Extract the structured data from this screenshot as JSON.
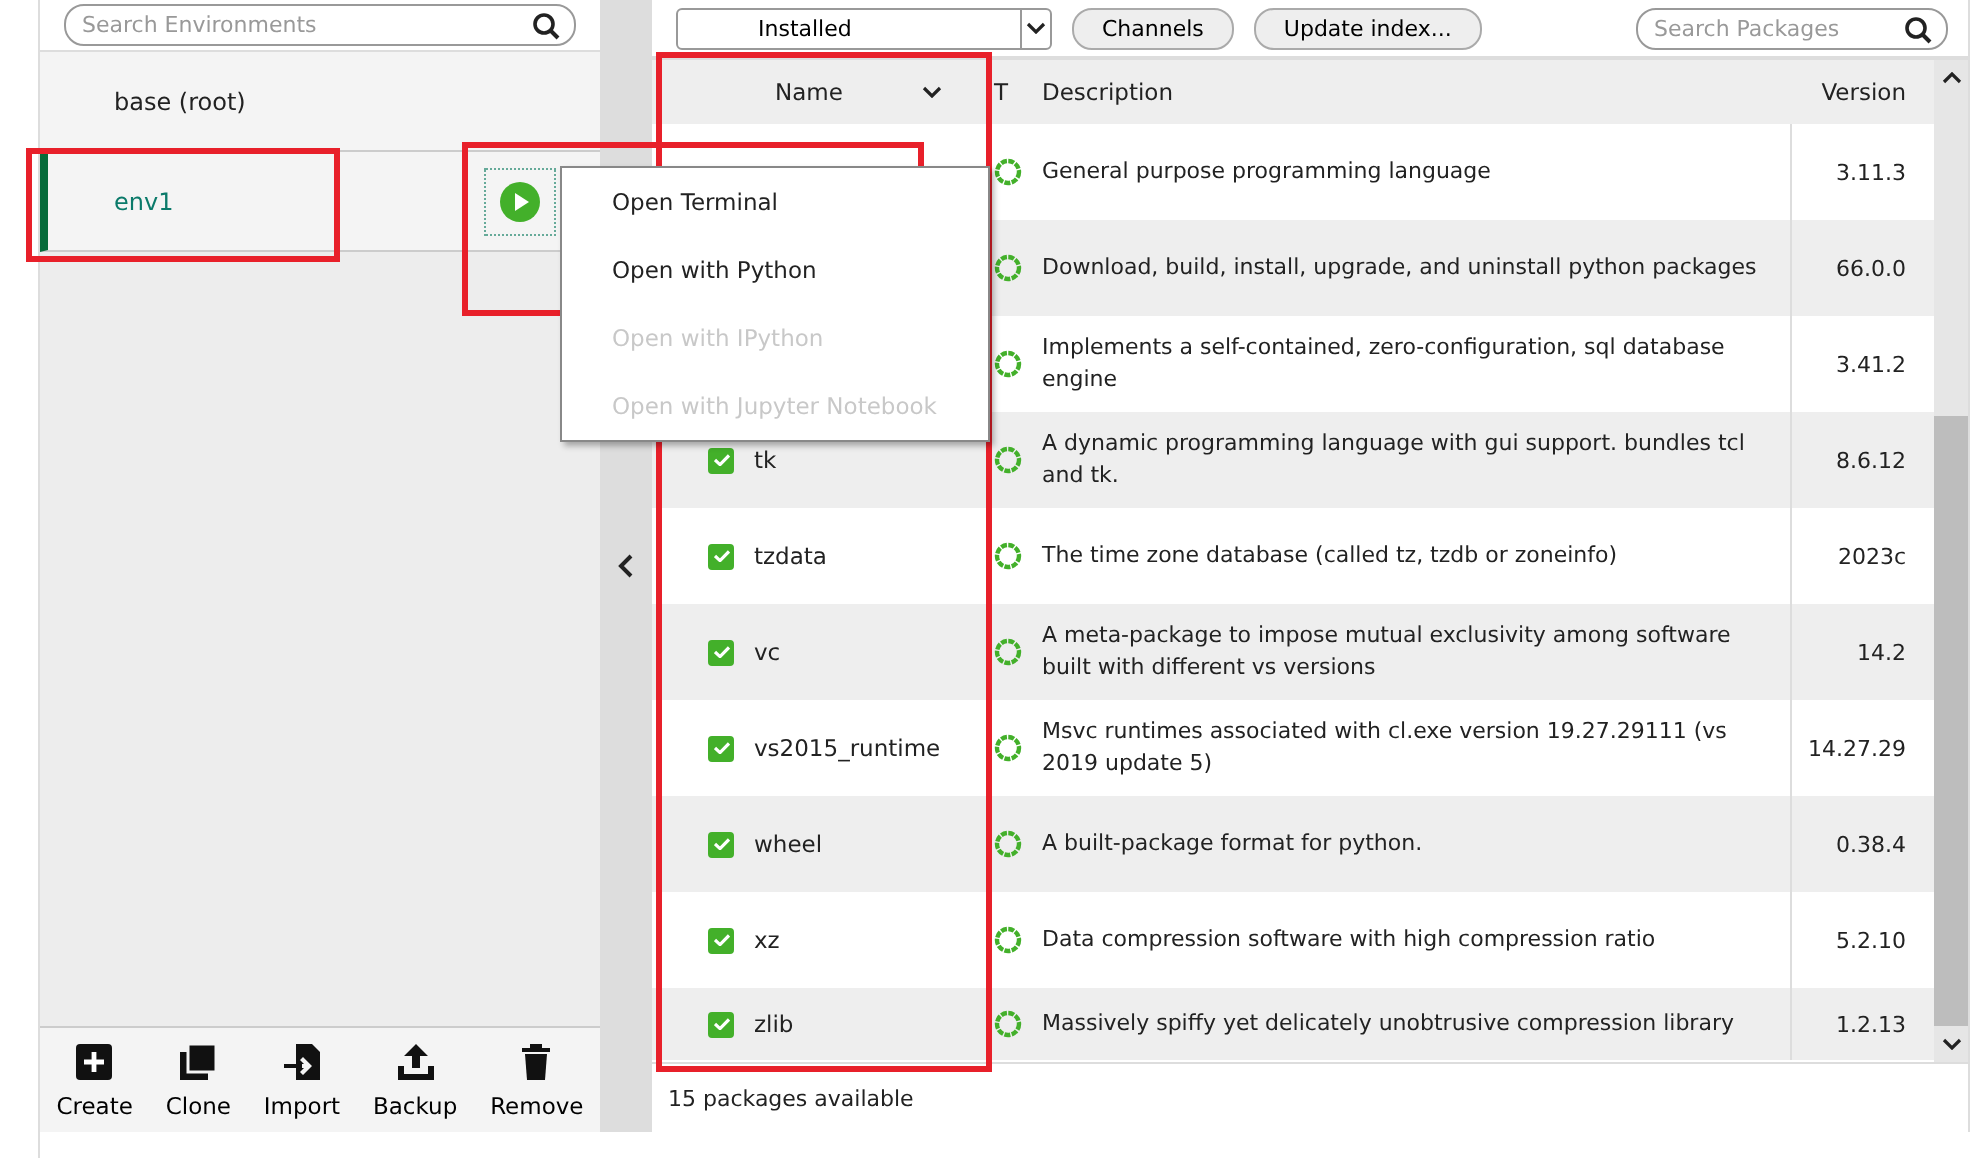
{
  "environments": {
    "search": {
      "placeholder": "Search Environments"
    },
    "items": [
      {
        "name": "base (root)",
        "selected": false,
        "running": false
      },
      {
        "name": "env1",
        "selected": true,
        "running": true
      }
    ],
    "actions": [
      {
        "kind": "create",
        "label": "Create"
      },
      {
        "kind": "clone",
        "label": "Clone"
      },
      {
        "kind": "import",
        "label": "Import"
      },
      {
        "kind": "backup",
        "label": "Backup"
      },
      {
        "kind": "remove",
        "label": "Remove"
      }
    ]
  },
  "context_menu": {
    "items": [
      {
        "label": "Open Terminal",
        "disabled": false
      },
      {
        "label": "Open with Python",
        "disabled": false
      },
      {
        "label": "Open with IPython",
        "disabled": true
      },
      {
        "label": "Open with Jupyter Notebook",
        "disabled": true
      }
    ]
  },
  "packages": {
    "filter": "Installed",
    "buttons": [
      "Channels",
      "Update index..."
    ],
    "search": {
      "placeholder": "Search Packages"
    },
    "columns": [
      "Name",
      "T",
      "Description",
      "Version"
    ],
    "rows": [
      {
        "description": "General purpose programming language",
        "version": "3.11.3"
      },
      {
        "description": "Download, build, install, upgrade, and uninstall python packages",
        "version": "66.0.0"
      },
      {
        "description": "Implements a self-contained, zero-configuration, sql database engine",
        "version": "3.41.2"
      },
      {
        "name": "tk",
        "checked": true,
        "description": "A dynamic programming language with gui support.  bundles tcl and tk.",
        "version": "8.6.12"
      },
      {
        "name": "tzdata",
        "checked": true,
        "description": "The time zone database (called tz, tzdb or zoneinfo)",
        "version": "2023c"
      },
      {
        "name": "vc",
        "checked": true,
        "description": "A meta-package to impose mutual exclusivity among software built with different vs versions",
        "version": "14.2"
      },
      {
        "name": "vs2015_runtime",
        "checked": true,
        "description": "Msvc runtimes associated with cl.exe version 19.27.29111 (vs 2019 update 5)",
        "version": "14.27.29"
      },
      {
        "name": "wheel",
        "checked": true,
        "description": "A built-package format for python.",
        "version": "0.38.4"
      },
      {
        "name": "xz",
        "checked": true,
        "description": "Data compression software with high compression ratio",
        "version": "5.2.10"
      },
      {
        "name": "zlib",
        "checked": true,
        "description": "Massively spiffy yet delicately unobtrusive compression library",
        "version": "1.2.13"
      }
    ],
    "status": "15 packages available"
  },
  "annotations": [
    {
      "kind": "environment"
    },
    {
      "kind": "menu"
    },
    {
      "kind": "name_column"
    }
  ]
}
